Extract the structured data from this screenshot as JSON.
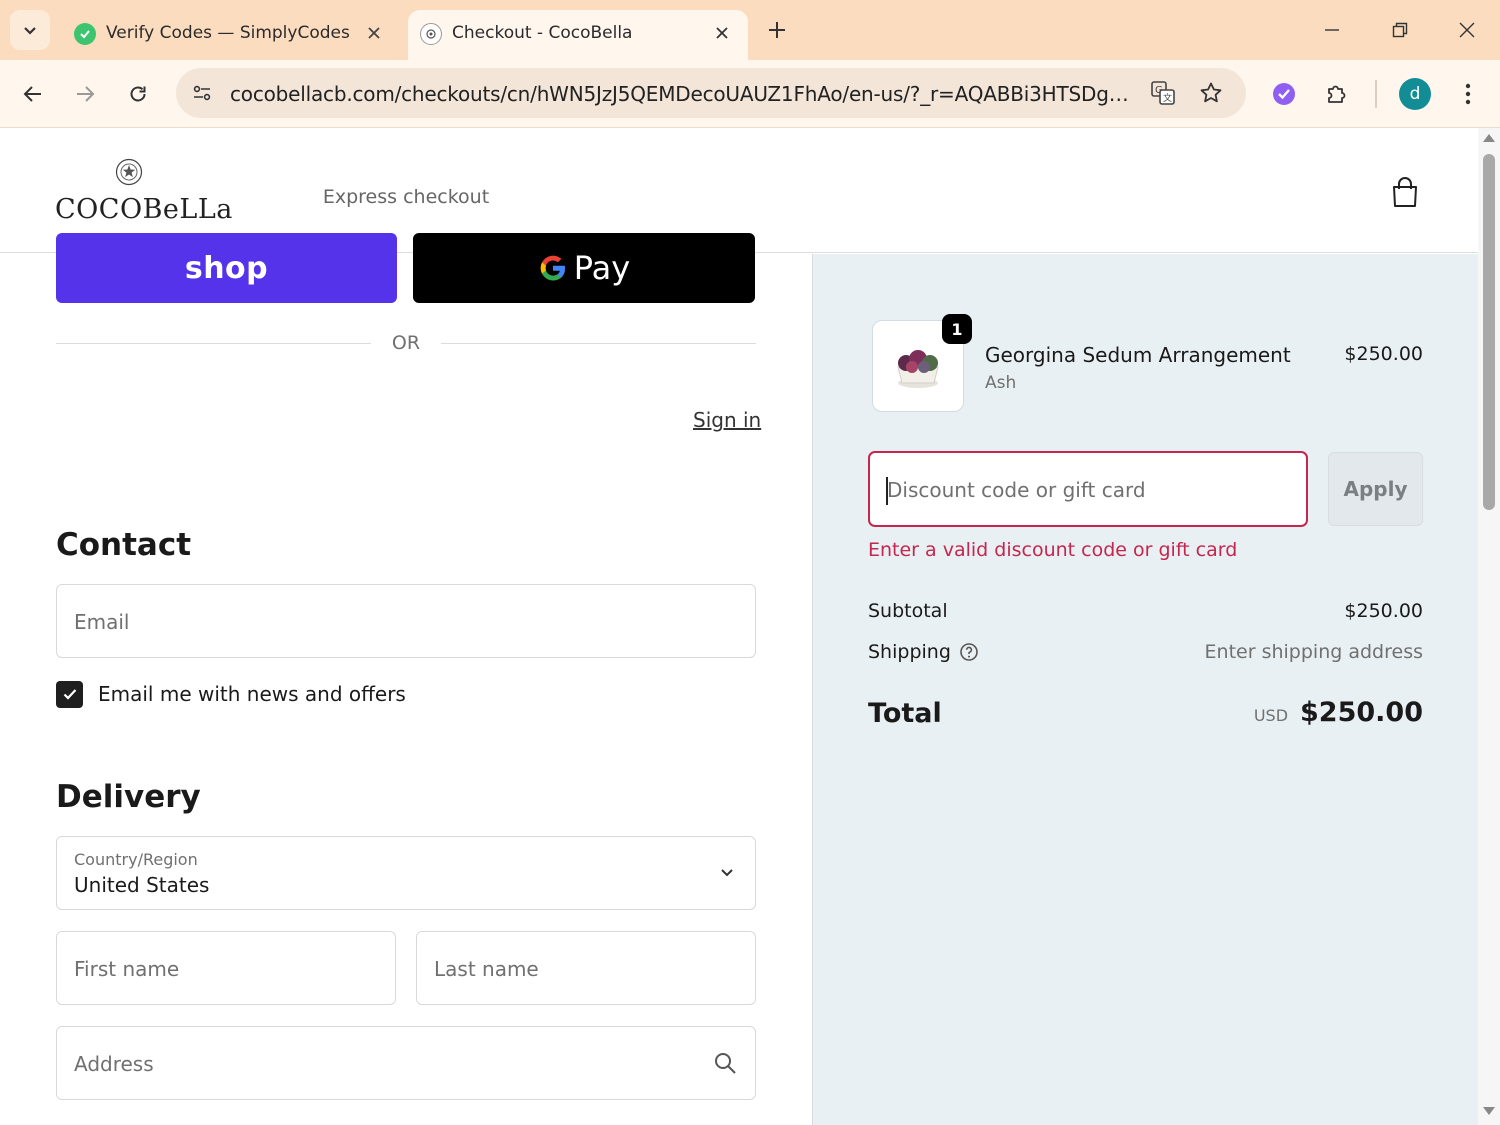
{
  "browser": {
    "tabs": [
      {
        "title": "Verify Codes — SimplyCodes",
        "active": false,
        "icon": "simplycodes-favicon"
      },
      {
        "title": "Checkout - CocoBella",
        "active": true,
        "icon": "cocobella-favicon"
      }
    ],
    "url": "cocobellacb.com/checkouts/cn/hWN5JzJ5QEMDecoUAUZ1FhAo/en-us/?_r=AQABBi3HTSDgCu58...",
    "avatar_letter": "d",
    "colors": {
      "tabstrip": "#fbdcbf",
      "toolbar": "#fff6ee",
      "avatar": "#138d95"
    }
  },
  "header": {
    "logo_text": "COCOBeLLa",
    "cart_icon": "shopping-bag-icon"
  },
  "checkout": {
    "express_label": "Express checkout",
    "shop_pay_label": "shop",
    "gpay_label": "Pay",
    "or_label": "OR",
    "contact": {
      "title": "Contact",
      "sign_in": "Sign in",
      "email_placeholder": "Email",
      "newsletter_label": "Email me with news and offers",
      "newsletter_checked": true
    },
    "delivery": {
      "title": "Delivery",
      "country_label": "Country/Region",
      "country_value": "United States",
      "first_name_placeholder": "First name",
      "last_name_placeholder": "Last name",
      "address_placeholder": "Address"
    }
  },
  "summary": {
    "item": {
      "quantity": "1",
      "name": "Georgina Sedum Arrangement",
      "variant": "Ash",
      "price": "$250.00"
    },
    "discount_placeholder": "Discount code or gift card",
    "apply_label": "Apply",
    "discount_error": "Enter a valid discount code or gift card",
    "subtotal_label": "Subtotal",
    "subtotal_value": "$250.00",
    "shipping_label": "Shipping",
    "shipping_value": "Enter shipping address",
    "total_label": "Total",
    "total_currency": "USD",
    "total_value": "$250.00",
    "colors": {
      "shop_pay": "#5433eb",
      "error": "#c4264e",
      "panel": "#e9f0f4"
    }
  }
}
